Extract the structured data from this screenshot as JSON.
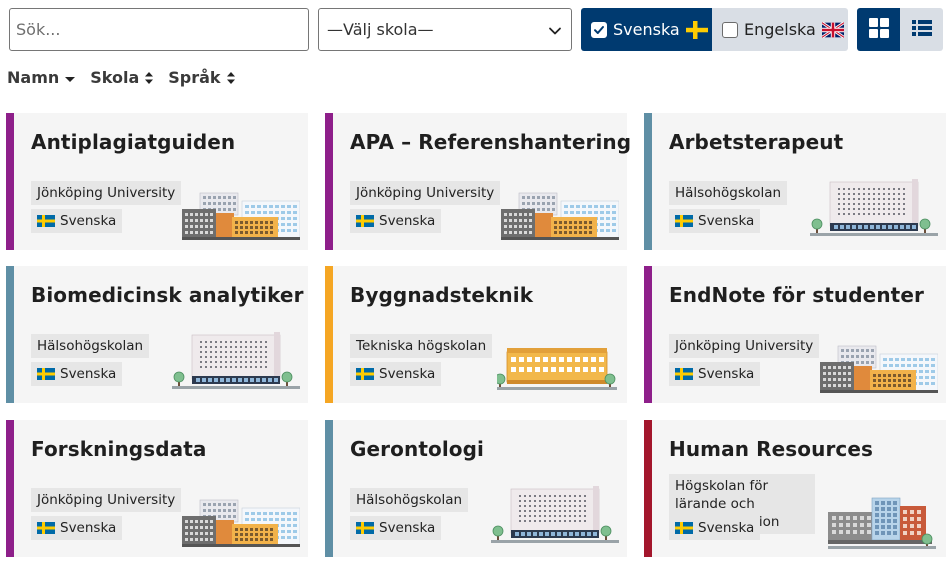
{
  "toolbar": {
    "search_placeholder": "Sök...",
    "school_select_value": "—Välj skola—",
    "lang_swedish_label": "Svenska",
    "lang_english_label": "Engelska",
    "swedish_checked": true,
    "english_checked": false,
    "active_view": "grid"
  },
  "sort": {
    "name_label": "Namn",
    "school_label": "Skola",
    "language_label": "Språk"
  },
  "cards": [
    {
      "title": "Antiplagiatguiden",
      "school": "Jönköping University",
      "language": "Svenska",
      "accent": "#8e1f8a",
      "building": "ju"
    },
    {
      "title": "APA – Referenshantering",
      "school": "Jönköping University",
      "language": "Svenska",
      "accent": "#8e1f8a",
      "building": "ju"
    },
    {
      "title": "Arbetsterapeut",
      "school": "Hälsohögskolan",
      "language": "Svenska",
      "accent": "#5f8fa5",
      "building": "hhj"
    },
    {
      "title": "Biomedicinsk analytiker",
      "school": "Hälsohögskolan",
      "language": "Svenska",
      "accent": "#5f8fa5",
      "building": "hhj"
    },
    {
      "title": "Byggnadsteknik",
      "school": "Tekniska högskolan",
      "language": "Svenska",
      "accent": "#f5a623",
      "building": "jth"
    },
    {
      "title": "EndNote för studenter",
      "school": "Jönköping University",
      "language": "Svenska",
      "accent": "#8e1f8a",
      "building": "ju"
    },
    {
      "title": "Forskningsdata",
      "school": "Jönköping University",
      "language": "Svenska",
      "accent": "#8e1f8a",
      "building": "ju"
    },
    {
      "title": "Gerontologi",
      "school": "Hälsohögskolan",
      "language": "Svenska",
      "accent": "#5f8fa5",
      "building": "hhj"
    },
    {
      "title": "Human Resources",
      "school": "Högskolan för lärande och kommunikation",
      "language": "Svenska",
      "accent": "#a3162c",
      "building": "hlk"
    }
  ],
  "colors": {
    "primary": "#003a70",
    "toggle_inactive": "#d9dee5",
    "card_bg": "#f5f5f5",
    "tag_bg": "#e6e6e6"
  }
}
